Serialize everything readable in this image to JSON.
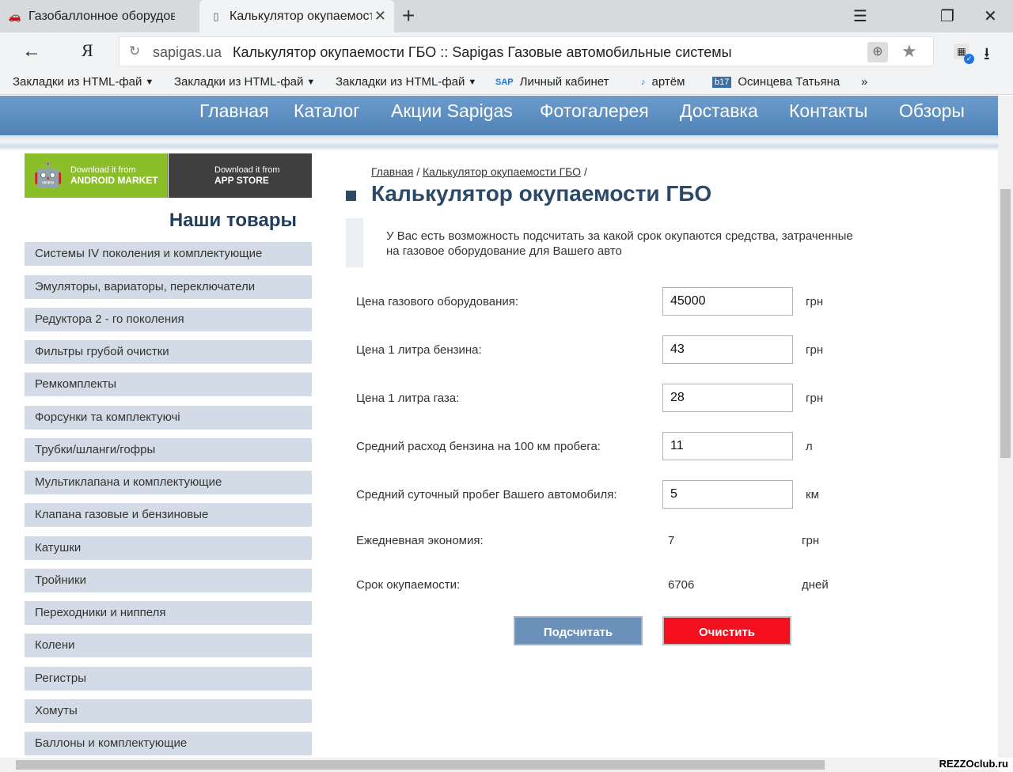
{
  "browser": {
    "tabs": [
      {
        "title": "Газобаллонное оборудова",
        "icon": "car-icon"
      },
      {
        "title": "Калькулятор окупаемост",
        "icon": "page-icon"
      }
    ],
    "address": {
      "domain": "sapigas.ua",
      "title": "Калькулятор окупаемости ГБО :: Sapigas Газовые автомобильные системы"
    },
    "bookmarks": [
      {
        "label": "Закладки из HTML-фай"
      },
      {
        "label": "Закладки из HTML-фай"
      },
      {
        "label": "Закладки из HTML-фай"
      },
      {
        "label": "Личный кабинет"
      },
      {
        "label": "артём"
      },
      {
        "label": "Осинцева Татьяна"
      }
    ]
  },
  "nav": [
    "Главная",
    "Каталог",
    "Акции Sapigas",
    "Фотогалерея",
    "Доставка",
    "Контакты",
    "Обзоры"
  ],
  "stores": {
    "android": {
      "line1": "Download it from",
      "line2": "ANDROID MARKET"
    },
    "apple": {
      "line1": "Download it from",
      "line2": "APP STORE"
    }
  },
  "sidebar": {
    "title": "Наши товары",
    "items": [
      "Системы IV поколения и комплектующие",
      "Эмуляторы, вариаторы, переключатели",
      "Редуктора 2 - го поколения",
      "Фильтры грубой очистки",
      "Ремкомплекты",
      "Форсунки та комплектуючі",
      "Трубки/шланги/гофры",
      "Мультиклапана и комплектующие",
      "Клапана газовые и бензиновые",
      "Катушки",
      "Тройники",
      "Переходники и ниппеля",
      "Колени",
      "Регистры",
      "Хомуты",
      "Баллоны и комплектующие"
    ]
  },
  "breadcrumb": {
    "home": "Главная",
    "current": "Калькулятор окупаемости ГБО",
    "sep": "/"
  },
  "heading": "Калькулятор окупаемости ГБО",
  "description": "У Вас есть возможность подсчитать за какой срок окупаются средства, затраченные на газовое оборудование для Вашего авто",
  "form": {
    "fields": [
      {
        "label": "Цена газового оборудования:",
        "value": "45000",
        "unit": "грн"
      },
      {
        "label": "Цена 1 литра бензина:",
        "value": "43",
        "unit": "грн"
      },
      {
        "label": "Цена 1 литра газа:",
        "value": "28",
        "unit": "грн"
      },
      {
        "label": "Средний расход бензина на 100 км пробега:",
        "value": "11",
        "unit": "л"
      },
      {
        "label": "Средний суточный пробег Вашего автомобиля:",
        "value": "5",
        "unit": "км"
      }
    ],
    "results": [
      {
        "label": "Ежедневная экономия:",
        "value": "7",
        "unit": "грн"
      },
      {
        "label": "Срок окупаемости:",
        "value": "6706",
        "unit": "дней"
      }
    ],
    "calc_label": "Подсчитать",
    "clear_label": "Очистить"
  },
  "watermark": "REZZOclub.ru",
  "colors": {
    "nav": "#5b8dc0",
    "sidebar_item": "#d3dce6",
    "heading": "#2b4a68",
    "clear_button": "#f50f1e",
    "calc_button": "#6b91bb"
  }
}
